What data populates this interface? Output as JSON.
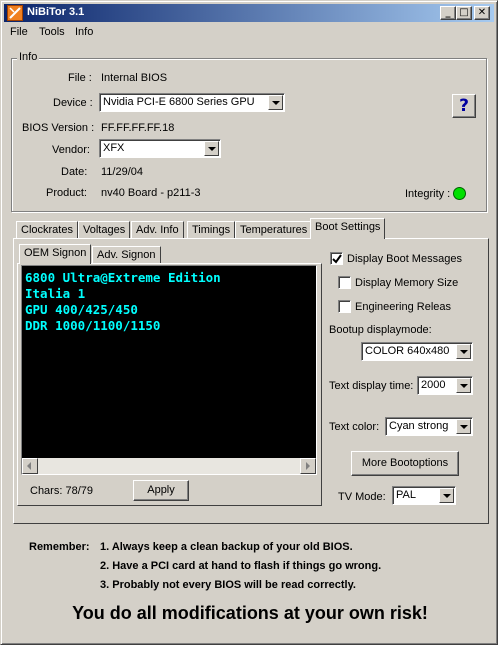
{
  "window": {
    "title": "NiBiTor 3.1"
  },
  "menu": {
    "file": "File",
    "tools": "Tools",
    "info": "Info"
  },
  "info": {
    "group_label": "Info",
    "file_label": "File :",
    "file_value": "Internal BIOS",
    "device_label": "Device :",
    "device_value": "Nvidia PCI-E 6800 Series GPU",
    "bios_version_label": "BIOS Version :",
    "bios_version_value": "FF.FF.FF.FF.18",
    "vendor_label": "Vendor:",
    "vendor_value": "XFX",
    "date_label": "Date:",
    "date_value": "11/29/04",
    "product_label": "Product:",
    "product_value": "nv40 Board - p211-3",
    "integrity_label": "Integrity :",
    "help_glyph": "?"
  },
  "tabs": [
    "Clockrates",
    "Voltages",
    "Adv. Info",
    "Timings",
    "Temperatures",
    "Boot Settings"
  ],
  "active_tab": "Boot Settings",
  "subtabs": [
    "OEM Signon",
    "Adv. Signon"
  ],
  "oem": {
    "lines": [
      "6800 Ultra@Extreme Edition",
      "Italia 1",
      "GPU 400/425/450",
      "DDR 1000/1100/1150"
    ],
    "chars_label": "Chars: 78/79",
    "apply_label": "Apply",
    "text_color": "#00ffff"
  },
  "boot": {
    "display_boot_messages": {
      "label": "Display Boot Messages",
      "checked": true
    },
    "display_memory_size": {
      "label": "Display Memory Size",
      "checked": false
    },
    "engineering_release": {
      "label": "Engineering Release",
      "checked": false
    },
    "displaymode_label": "Bootup displaymode:",
    "displaymode_value": "COLOR 640x480",
    "text_display_time_label": "Text display time:",
    "text_display_time_value": "2000",
    "text_color_label": "Text color:",
    "text_color_value": "Cyan strong",
    "more_bootoptions_label": "More Bootoptions",
    "tv_mode_label": "TV Mode:",
    "tv_mode_value": "PAL"
  },
  "remember": {
    "label": "Remember:",
    "items": [
      "1. Always keep a clean backup of your old BIOS.",
      "2. Have a PCI card at hand to flash if things go wrong.",
      "3. Probably not every BIOS will be read correctly."
    ]
  },
  "warning": "You do all modifications at your own risk!",
  "colors": {
    "titlebar_start": "#0a246a",
    "titlebar_end": "#a6caf0",
    "integrity_led": "#00e000",
    "memo_bg": "#000000"
  }
}
